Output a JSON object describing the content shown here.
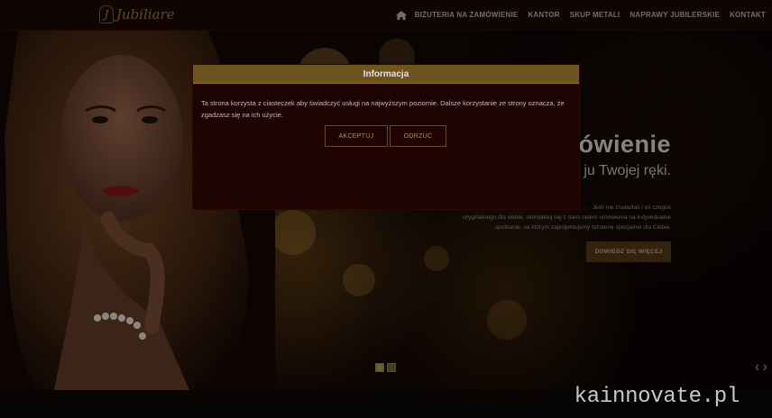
{
  "header": {
    "logo_text": "Jubiliare",
    "nav": [
      {
        "label": "BIŻUTERIA NA ZAMÓWIENIE"
      },
      {
        "label": "KANTOR"
      },
      {
        "label": "SKUP METALI"
      },
      {
        "label": "NAPRAWY JUBILERSKIE"
      },
      {
        "label": "KONTAKT"
      }
    ]
  },
  "hero": {
    "title": "ówienie",
    "subtitle": "ju Twojej ręki.",
    "text_lines": [
      ". Jeśli nie znalazłaś / eś czegoś",
      "oryginalnego dla siebie, skontaktuj się z nami celem umówienia na indywidualne",
      "spotkanie, na którym zaprojektujemy biżuterię specjalnie dla Ciebie."
    ],
    "button_label": "DOWIEDZ SIĘ WIĘCEJ",
    "slider": {
      "slides": 2,
      "active": 1
    }
  },
  "modal": {
    "title": "Informacja",
    "body": "Ta strona korzysta z ciasteczek aby świadczyć usługi na najwyższym poziomie. Dalsze korzystanie ze strony oznacza, że zgadzasz się na ich użycie.",
    "accept_label": "AKCEPTUJ",
    "reject_label": "ODRZUĆ"
  },
  "watermark": "kainnovate.pl",
  "colors": {
    "accent_gold": "#6e5520",
    "modal_bg": "#1e0301",
    "header_bg": "#1a0807"
  }
}
